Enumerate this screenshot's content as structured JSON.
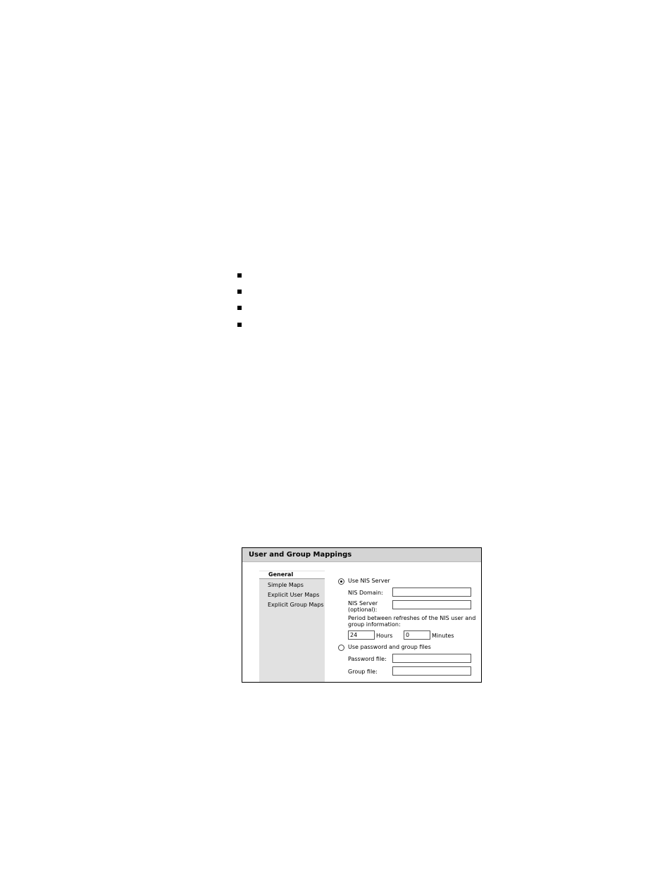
{
  "panel": {
    "title": "User and Group Mappings"
  },
  "nav": {
    "items": [
      {
        "label": "General",
        "active": true
      },
      {
        "label": "Simple Maps",
        "active": false
      },
      {
        "label": "Explicit User Maps",
        "active": false
      },
      {
        "label": "Explicit Group Maps",
        "active": false
      }
    ]
  },
  "general": {
    "use_nis_label": "Use NIS Server",
    "use_nis_selected": true,
    "nis_domain_label": "NIS Domain:",
    "nis_domain_value": "",
    "nis_server_label_1": "NIS Server",
    "nis_server_label_2": "(optional):",
    "nis_server_value": "",
    "refresh_text_1": "Period between refreshes of the NIS user and",
    "refresh_text_2": "group information:",
    "hours_value": "24",
    "hours_label": "Hours",
    "minutes_value": "0",
    "minutes_label": "Minutes",
    "use_files_label": "Use password and group files",
    "use_files_selected": false,
    "password_file_label": "Password file:",
    "password_file_value": "",
    "group_file_label": "Group file:",
    "group_file_value": ""
  },
  "icons": {
    "bullet": "square-bullet-icon"
  }
}
